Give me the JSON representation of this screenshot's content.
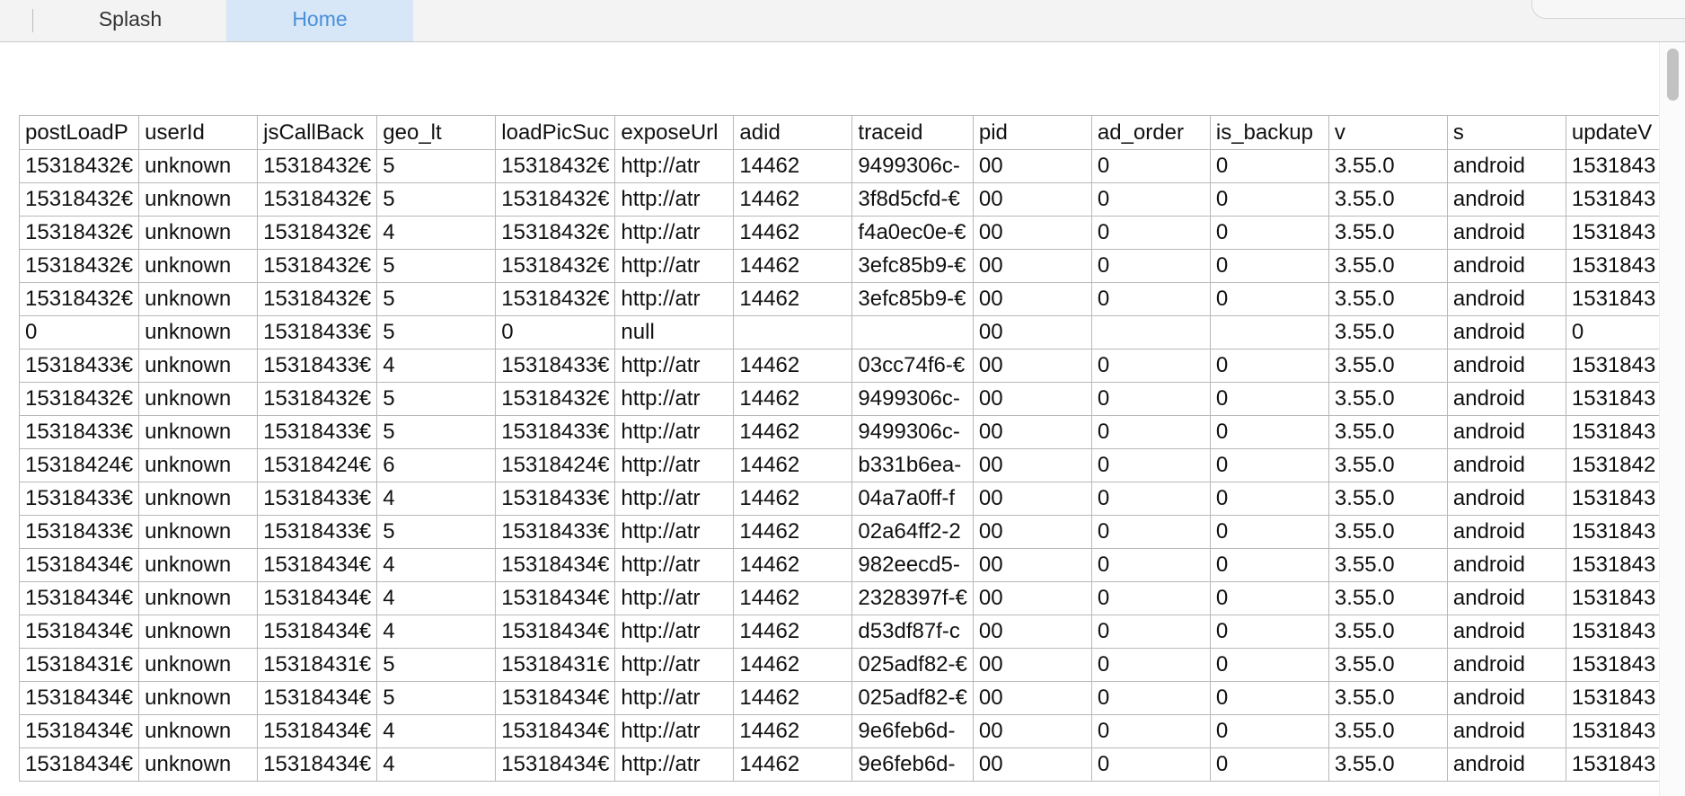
{
  "tabs": [
    {
      "label": "Splash",
      "active": false
    },
    {
      "label": "Home",
      "active": true
    }
  ],
  "colors": {
    "active_tab_bg": "#d7e7f8",
    "active_tab_text": "#4a8fd9"
  },
  "table": {
    "columns": [
      "postLoadP",
      "userId",
      "jsCallBack",
      "geo_lt",
      "loadPicSuc",
      "exposeUrl",
      "adid",
      "traceid",
      "pid",
      "ad_order",
      "is_backup",
      "v",
      "s",
      "updateV"
    ],
    "rows": [
      [
        "15318432€",
        "unknown",
        "15318432€",
        "5",
        "15318432€",
        "http://atr",
        "14462",
        "9499306c-",
        "00",
        "0",
        "0",
        "3.55.0",
        "android",
        "1531843"
      ],
      [
        "15318432€",
        "unknown",
        "15318432€",
        "5",
        "15318432€",
        "http://atr",
        "14462",
        "3f8d5cfd-€",
        "00",
        "0",
        "0",
        "3.55.0",
        "android",
        "1531843"
      ],
      [
        "15318432€",
        "unknown",
        "15318432€",
        "4",
        "15318432€",
        "http://atr",
        "14462",
        "f4a0ec0e-€",
        "00",
        "0",
        "0",
        "3.55.0",
        "android",
        "1531843"
      ],
      [
        "15318432€",
        "unknown",
        "15318432€",
        "5",
        "15318432€",
        "http://atr",
        "14462",
        "3efc85b9-€",
        "00",
        "0",
        "0",
        "3.55.0",
        "android",
        "1531843"
      ],
      [
        "15318432€",
        "unknown",
        "15318432€",
        "5",
        "15318432€",
        "http://atr",
        "14462",
        "3efc85b9-€",
        "00",
        "0",
        "0",
        "3.55.0",
        "android",
        "1531843"
      ],
      [
        "0",
        "unknown",
        "15318433€",
        "5",
        "0",
        "null",
        "",
        "",
        "00",
        "",
        "",
        "3.55.0",
        "android",
        "0"
      ],
      [
        "15318433€",
        "unknown",
        "15318433€",
        "4",
        "15318433€",
        "http://atr",
        "14462",
        "03cc74f6-€",
        "00",
        "0",
        "0",
        "3.55.0",
        "android",
        "1531843"
      ],
      [
        "15318432€",
        "unknown",
        "15318432€",
        "5",
        "15318432€",
        "http://atr",
        "14462",
        "9499306c-",
        "00",
        "0",
        "0",
        "3.55.0",
        "android",
        "1531843"
      ],
      [
        "15318433€",
        "unknown",
        "15318433€",
        "5",
        "15318433€",
        "http://atr",
        "14462",
        "9499306c-",
        "00",
        "0",
        "0",
        "3.55.0",
        "android",
        "1531843"
      ],
      [
        "15318424€",
        "unknown",
        "15318424€",
        "6",
        "15318424€",
        "http://atr",
        "14462",
        "b331b6ea-",
        "00",
        "0",
        "0",
        "3.55.0",
        "android",
        "1531842"
      ],
      [
        "15318433€",
        "unknown",
        "15318433€",
        "4",
        "15318433€",
        "http://atr",
        "14462",
        "04a7a0ff-f",
        "00",
        "0",
        "0",
        "3.55.0",
        "android",
        "1531843"
      ],
      [
        "15318433€",
        "unknown",
        "15318433€",
        "5",
        "15318433€",
        "http://atr",
        "14462",
        "02a64ff2-2",
        "00",
        "0",
        "0",
        "3.55.0",
        "android",
        "1531843"
      ],
      [
        "15318434€",
        "unknown",
        "15318434€",
        "4",
        "15318434€",
        "http://atr",
        "14462",
        "982eecd5-",
        "00",
        "0",
        "0",
        "3.55.0",
        "android",
        "1531843"
      ],
      [
        "15318434€",
        "unknown",
        "15318434€",
        "4",
        "15318434€",
        "http://atr",
        "14462",
        "2328397f-€",
        "00",
        "0",
        "0",
        "3.55.0",
        "android",
        "1531843"
      ],
      [
        "15318434€",
        "unknown",
        "15318434€",
        "4",
        "15318434€",
        "http://atr",
        "14462",
        "d53df87f-c",
        "00",
        "0",
        "0",
        "3.55.0",
        "android",
        "1531843"
      ],
      [
        "15318431€",
        "unknown",
        "15318431€",
        "5",
        "15318431€",
        "http://atr",
        "14462",
        "025adf82-€",
        "00",
        "0",
        "0",
        "3.55.0",
        "android",
        "1531843"
      ],
      [
        "15318434€",
        "unknown",
        "15318434€",
        "5",
        "15318434€",
        "http://atr",
        "14462",
        "025adf82-€",
        "00",
        "0",
        "0",
        "3.55.0",
        "android",
        "1531843"
      ],
      [
        "15318434€",
        "unknown",
        "15318434€",
        "4",
        "15318434€",
        "http://atr",
        "14462",
        "9e6feb6d-",
        "00",
        "0",
        "0",
        "3.55.0",
        "android",
        "1531843"
      ],
      [
        "15318434€",
        "unknown",
        "15318434€",
        "4",
        "15318434€",
        "http://atr",
        "14462",
        "9e6feb6d-",
        "00",
        "0",
        "0",
        "3.55.0",
        "android",
        "1531843"
      ]
    ]
  }
}
